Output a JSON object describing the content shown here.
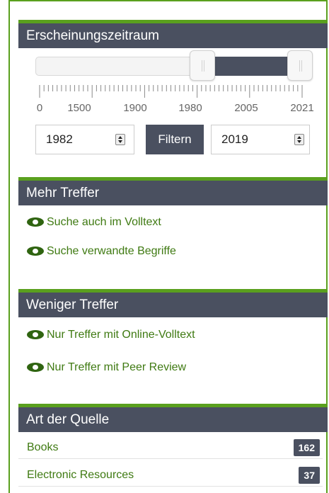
{
  "date_filter": {
    "title": "Erscheinungszeitraum",
    "scale_labels": [
      "0",
      "1500",
      "1900",
      "1980",
      "2005",
      "2021"
    ],
    "range_from": "1982",
    "range_to": "2019",
    "filter_button": "Filtern"
  },
  "more_hits": {
    "title": "Mehr Treffer",
    "links": [
      "Suche auch im Volltext",
      "Suche verwandte Begriffe"
    ]
  },
  "fewer_hits": {
    "title": "Weniger Treffer",
    "links": [
      "Nur Treffer mit Online-Volltext",
      "Nur Treffer mit Peer Review"
    ]
  },
  "source_type": {
    "title": "Art der Quelle",
    "items": [
      {
        "label": "Books",
        "count": "162"
      },
      {
        "label": "Electronic Resources",
        "count": "37"
      }
    ]
  },
  "colors": {
    "accent": "#5aa01e",
    "header": "#4a5060",
    "link": "#3f7a12"
  },
  "icons": {
    "link_icon": "eye-icon",
    "spinner": "up-down-spinner-icon"
  }
}
